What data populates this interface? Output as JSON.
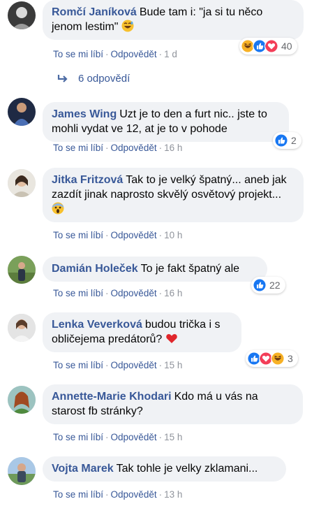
{
  "actions": {
    "like": "To se mi líbí",
    "reply": "Odpovědět",
    "sep": "·"
  },
  "colors": {
    "link": "#385898",
    "bubble": "#f0f2f5",
    "like_blue": "#1877f2",
    "love_red": "#f33e58",
    "haha_yellow": "#f7b125"
  },
  "comments": [
    {
      "author": "Romčí Janíková",
      "text": "Bude tam i: \"ja si tu něco jenom lestim\"",
      "emoji": "grinning-sweat-emoji",
      "time": "1 d",
      "reactions": [
        "haha",
        "like",
        "love"
      ],
      "count": "40"
    },
    {
      "author": "James Wing",
      "text": "Uzt je to den a furt nic.. jste to mohli vydat ve 12, at je to v pohode",
      "time": "16 h",
      "reactions": [
        "like"
      ],
      "count": "2"
    },
    {
      "author": "Jitka Fritzová",
      "text": "Tak to je velký špatný... aneb jak zazdít jinak naprosto skvělý osvětový projekt...",
      "emoji": "scream-emoji",
      "time": "10 h"
    },
    {
      "author": "Damián Holeček",
      "text": "To je fakt špatný ale",
      "time": "16 h",
      "reactions": [
        "like"
      ],
      "count": "22"
    },
    {
      "author": "Lenka Veverková",
      "text": "budou trička i s obličejema predátorů?",
      "emoji": "red-heart-emoji",
      "time": "15 h",
      "reactions": [
        "like",
        "love",
        "haha"
      ],
      "count": "3"
    },
    {
      "author": "Annette-Marie Khodari",
      "text": "Kdo má u vás na starost fb stránky?",
      "time": "15 h"
    },
    {
      "author": "Vojta Marek",
      "text": "Tak tohle je velky zklamani...",
      "time": "13 h"
    }
  ],
  "replies_link": {
    "label": "6 odpovědí",
    "icon": "reply-arrow-icon"
  }
}
